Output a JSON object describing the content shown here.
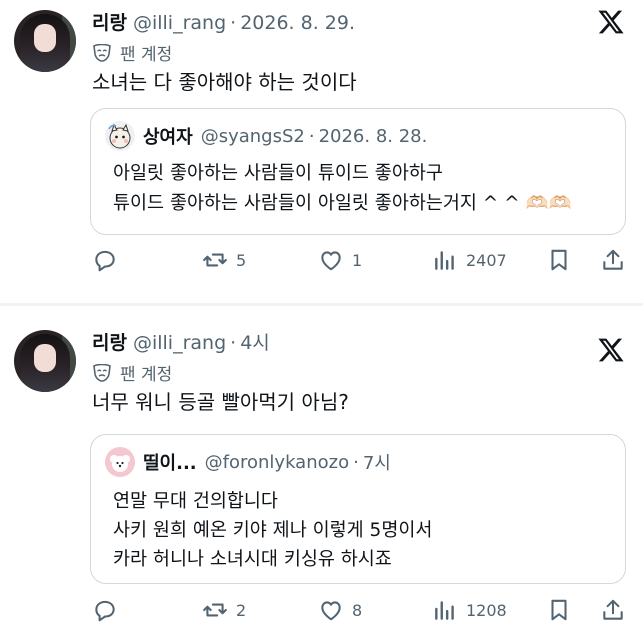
{
  "tweets": [
    {
      "author": {
        "name": "리랑",
        "handle": "@illi_rang",
        "time": "2026. 8. 29.",
        "badge": "팬 계정"
      },
      "text": "소녀는 다 좋아해야 하는 것이다",
      "quote": {
        "author": {
          "name": "상여자",
          "handle": "@syangsS2",
          "time": "2026. 8. 28."
        },
        "lines": [
          "아일릿 좋아하는 사람들이 튜이드 좋아하구",
          "튜이드 좋아하는 사람들이 아일릿 좋아하는거지 ^ ^ 🫶🏻🫶🏻"
        ]
      },
      "actions": {
        "reply": "",
        "retweets": "5",
        "likes": "1",
        "views": "2407"
      }
    },
    {
      "author": {
        "name": "리랑",
        "handle": "@illi_rang",
        "time": "4시",
        "badge": "팬 계정"
      },
      "text": "너무 워니 등골 빨아먹기 아님?",
      "quote": {
        "author": {
          "name": "띨이...",
          "handle": "@foronlykanozo",
          "time": "7시"
        },
        "lines": [
          "연말 무대 건의합니다",
          "사키 원희 예온 키야 제나 이렇게 5명이서",
          "카라 허니나 소녀시대 키싱유 하시죠"
        ]
      },
      "actions": {
        "reply": "",
        "retweets": "2",
        "likes": "8",
        "views": "1208"
      }
    }
  ],
  "icons": [
    "x-logo-icon",
    "mask-icon",
    "reply-icon",
    "retweet-icon",
    "like-icon",
    "views-icon",
    "bookmark-icon",
    "share-icon"
  ],
  "colors": {
    "text": "#0f1419",
    "secondary": "#536471",
    "border": "#cfd9de",
    "separator": "#eff3f4"
  }
}
